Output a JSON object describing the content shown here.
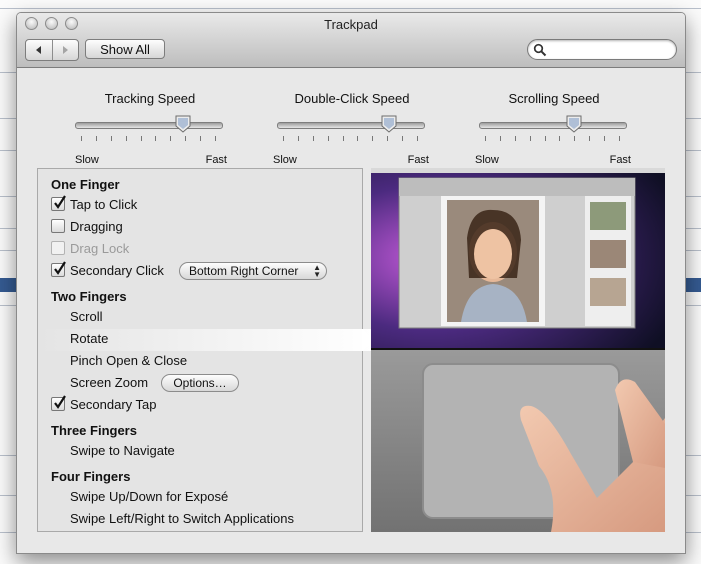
{
  "window": {
    "title": "Trackpad"
  },
  "toolbar": {
    "show_all_label": "Show All",
    "back_icon": "back-arrow-icon",
    "forward_icon": "forward-arrow-icon",
    "search_icon": "search-icon"
  },
  "sliders": [
    {
      "label": "Tracking Speed",
      "min_label": "Slow",
      "max_label": "Fast",
      "value": 0.74
    },
    {
      "label": "Double-Click Speed",
      "min_label": "Slow",
      "max_label": "Fast",
      "value": 0.77
    },
    {
      "label": "Scrolling Speed",
      "min_label": "Slow",
      "max_label": "Fast",
      "value": 0.65
    }
  ],
  "gestures": {
    "one_finger": {
      "title": "One Finger",
      "tap_to_click": {
        "label": "Tap to Click",
        "checked": true
      },
      "dragging": {
        "label": "Dragging",
        "checked": false
      },
      "drag_lock": {
        "label": "Drag Lock",
        "checked": false,
        "enabled": false
      },
      "secondary_click": {
        "label": "Secondary Click",
        "checked": true,
        "option": "Bottom Right Corner"
      }
    },
    "two_fingers": {
      "title": "Two Fingers",
      "scroll": "Scroll",
      "rotate": "Rotate",
      "pinch": "Pinch Open & Close",
      "screen_zoom": "Screen Zoom",
      "options_label": "Options…",
      "secondary_tap": {
        "label": "Secondary Tap",
        "checked": true
      }
    },
    "three_fingers": {
      "title": "Three Fingers",
      "swipe": "Swipe to Navigate"
    },
    "four_fingers": {
      "title": "Four Fingers",
      "expose": "Swipe Up/Down for Exposé",
      "switch_apps": "Swipe Left/Right to Switch Applications"
    }
  },
  "selected_gesture": "Rotate",
  "colors": {
    "window_bg": "#e8e8e8",
    "selection_row": "#ffffff",
    "preview_bg": "#111111"
  }
}
